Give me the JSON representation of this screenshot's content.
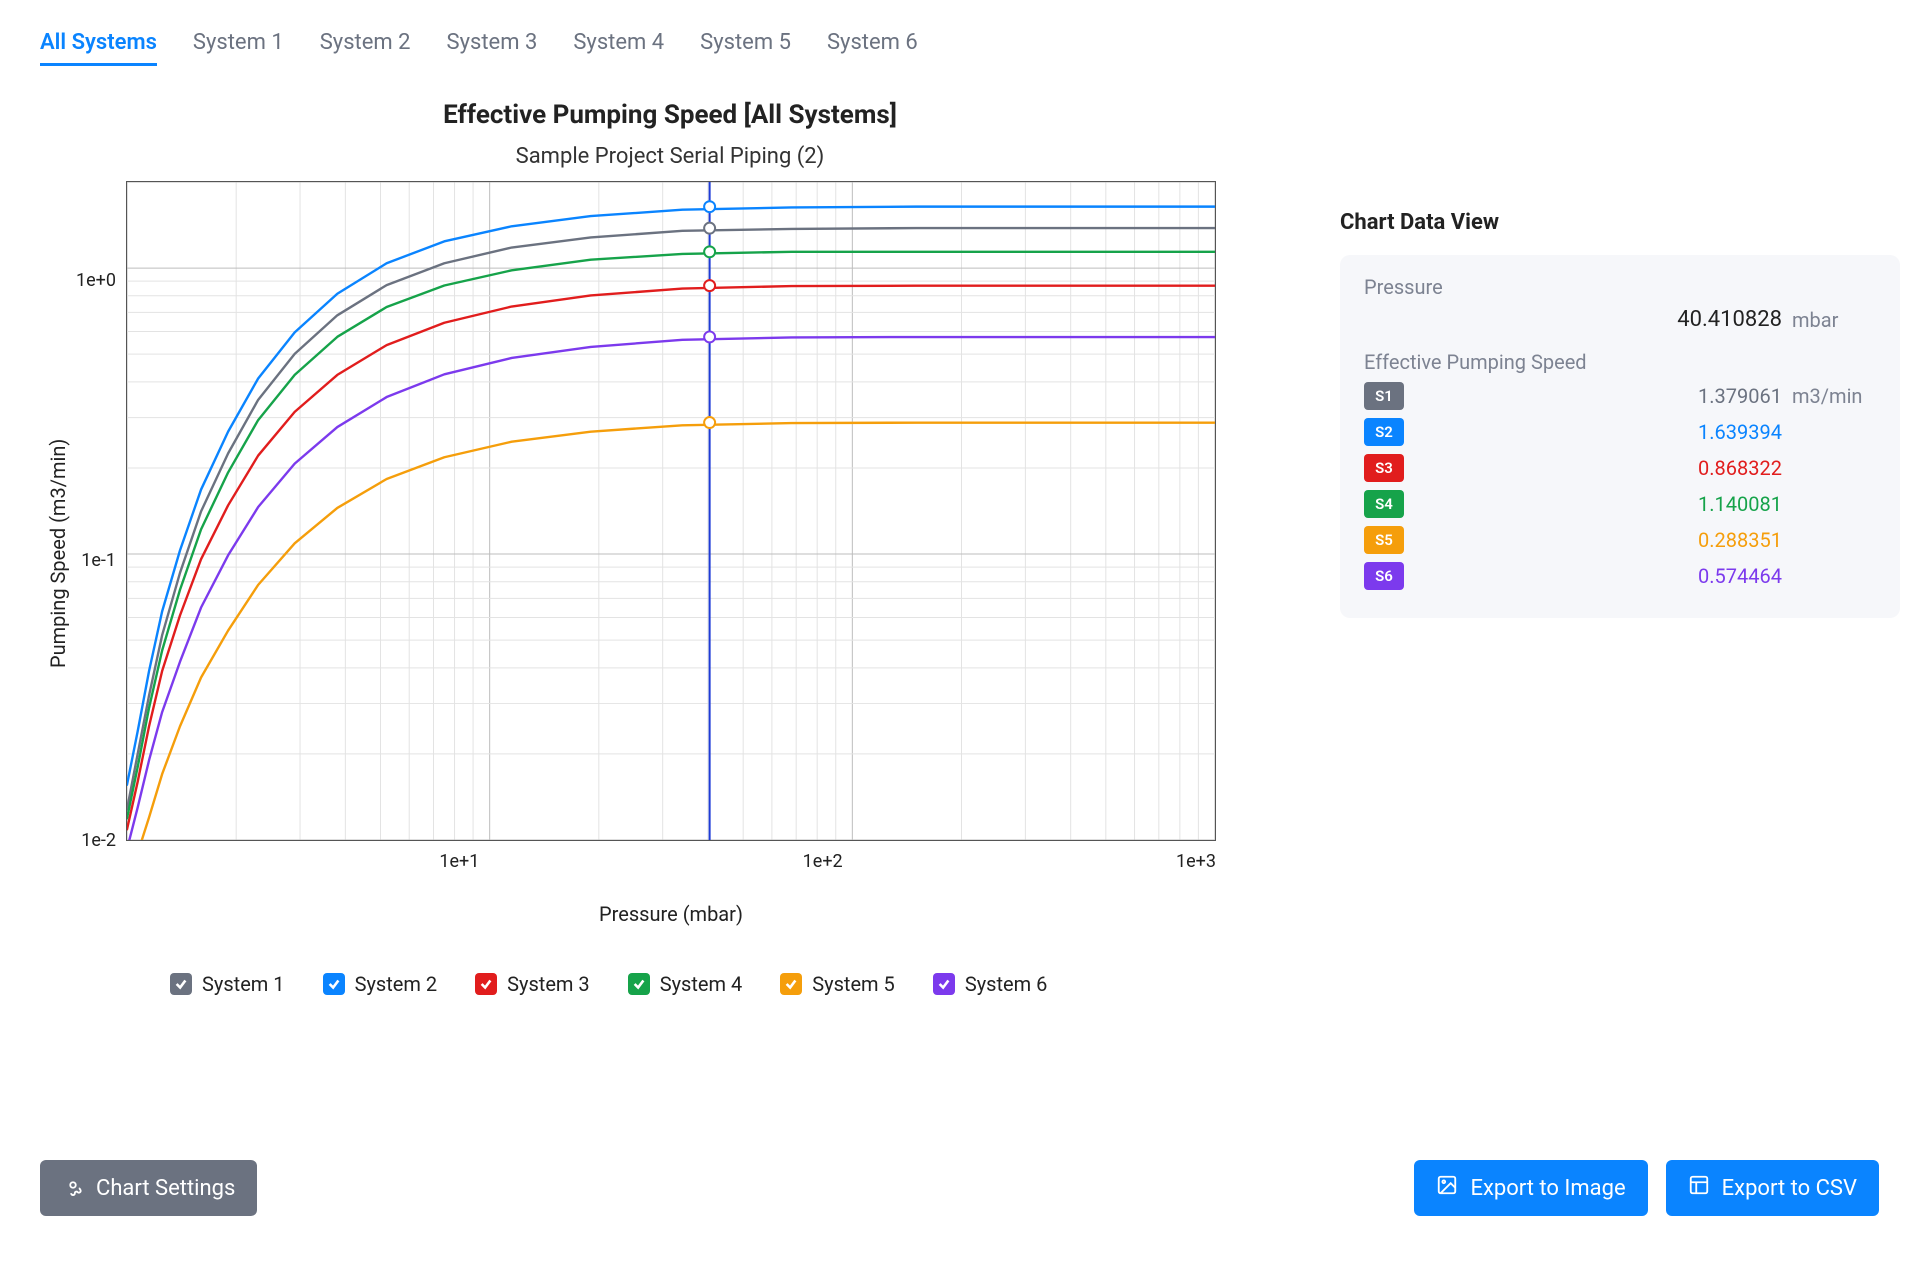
{
  "tabs": [
    {
      "label": "All Systems",
      "active": true
    },
    {
      "label": "System 1"
    },
    {
      "label": "System 2"
    },
    {
      "label": "System 3"
    },
    {
      "label": "System 4"
    },
    {
      "label": "System 5"
    },
    {
      "label": "System 6"
    }
  ],
  "chart_title": "Effective Pumping Speed [All Systems]",
  "chart_subtitle": "Sample Project Serial Piping (2)",
  "x_axis_label": "Pressure (mbar)",
  "y_axis_label": "Pumping Speed (m3/min)",
  "legend": [
    {
      "label": "System 1",
      "color": "#6b7280"
    },
    {
      "label": "System 2",
      "color": "#0a84ff"
    },
    {
      "label": "System 3",
      "color": "#e11d1d"
    },
    {
      "label": "System 4",
      "color": "#16a34a"
    },
    {
      "label": "System 5",
      "color": "#f59e0b"
    },
    {
      "label": "System 6",
      "color": "#7c3aed"
    }
  ],
  "y_ticks": [
    "1e+0",
    "1e-1",
    "1e-2"
  ],
  "x_ticks": [
    "1e+1",
    "1e+2",
    "1e+3"
  ],
  "data_view": {
    "title": "Chart Data View",
    "pressure_label": "Pressure",
    "pressure_value": "40.410828",
    "pressure_unit": "mbar",
    "eps_label": "Effective Pumping Speed",
    "eps_unit": "m3/min",
    "series": [
      {
        "badge": "S1",
        "color": "#6b7280",
        "value": "1.379061"
      },
      {
        "badge": "S2",
        "color": "#0a84ff",
        "value": "1.639394"
      },
      {
        "badge": "S3",
        "color": "#e11d1d",
        "value": "0.868322"
      },
      {
        "badge": "S4",
        "color": "#16a34a",
        "value": "1.140081"
      },
      {
        "badge": "S5",
        "color": "#f59e0b",
        "value": "0.288351"
      },
      {
        "badge": "S6",
        "color": "#7c3aed",
        "value": "0.574464"
      }
    ]
  },
  "buttons": {
    "chart_settings": "Chart Settings",
    "export_image": "Export to Image",
    "export_csv": "Export to CSV"
  },
  "chart_data": {
    "type": "line",
    "title": "Effective Pumping Speed [All Systems]",
    "subtitle": "Sample Project Serial Piping (2)",
    "xlabel": "Pressure (mbar)",
    "ylabel": "Pumping Speed (m3/min)",
    "x_scale": "log",
    "y_scale": "log",
    "xlim": [
      1,
      1000
    ],
    "ylim": [
      0.01,
      2.0
    ],
    "x_ticks": [
      10,
      100,
      1000
    ],
    "y_ticks": [
      1.0,
      0.1,
      0.01
    ],
    "marker_x": 40.410828,
    "x": [
      1.0,
      1.07,
      1.15,
      1.25,
      1.4,
      1.6,
      1.9,
      2.3,
      2.9,
      3.8,
      5.2,
      7.5,
      11.5,
      19,
      34,
      68,
      150,
      1000
    ],
    "series": [
      {
        "name": "System 1",
        "color": "#6b7280",
        "plateau": 1.379061,
        "values": [
          0.0128,
          0.02,
          0.032,
          0.052,
          0.086,
          0.141,
          0.225,
          0.346,
          0.501,
          0.684,
          0.872,
          1.04,
          1.18,
          1.28,
          1.35,
          1.37,
          1.38,
          1.38
        ]
      },
      {
        "name": "System 2",
        "color": "#0a84ff",
        "plateau": 1.639394,
        "values": [
          0.0156,
          0.024,
          0.039,
          0.063,
          0.103,
          0.168,
          0.268,
          0.411,
          0.596,
          0.813,
          1.04,
          1.24,
          1.4,
          1.52,
          1.6,
          1.63,
          1.64,
          1.64
        ]
      },
      {
        "name": "System 3",
        "color": "#e11d1d",
        "plateau": 0.868322,
        "values": [
          0.0109,
          0.016,
          0.025,
          0.039,
          0.061,
          0.096,
          0.148,
          0.221,
          0.314,
          0.423,
          0.538,
          0.644,
          0.734,
          0.802,
          0.848,
          0.865,
          0.868,
          0.868
        ]
      },
      {
        "name": "System 4",
        "color": "#16a34a",
        "plateau": 1.140081,
        "values": [
          0.0119,
          0.018,
          0.029,
          0.046,
          0.075,
          0.122,
          0.193,
          0.294,
          0.423,
          0.575,
          0.731,
          0.869,
          0.982,
          1.07,
          1.12,
          1.14,
          1.14,
          1.14
        ]
      },
      {
        "name": "System 5",
        "color": "#f59e0b",
        "plateau": 0.288351,
        "values": [
          0.00674,
          0.009,
          0.012,
          0.017,
          0.025,
          0.037,
          0.054,
          0.078,
          0.109,
          0.145,
          0.183,
          0.218,
          0.247,
          0.268,
          0.282,
          0.287,
          0.288,
          0.288
        ]
      },
      {
        "name": "System 6",
        "color": "#7c3aed",
        "plateau": 0.574464,
        "values": [
          0.00928,
          0.013,
          0.019,
          0.028,
          0.042,
          0.065,
          0.099,
          0.146,
          0.207,
          0.278,
          0.354,
          0.425,
          0.485,
          0.53,
          0.561,
          0.572,
          0.574,
          0.574
        ]
      }
    ]
  }
}
